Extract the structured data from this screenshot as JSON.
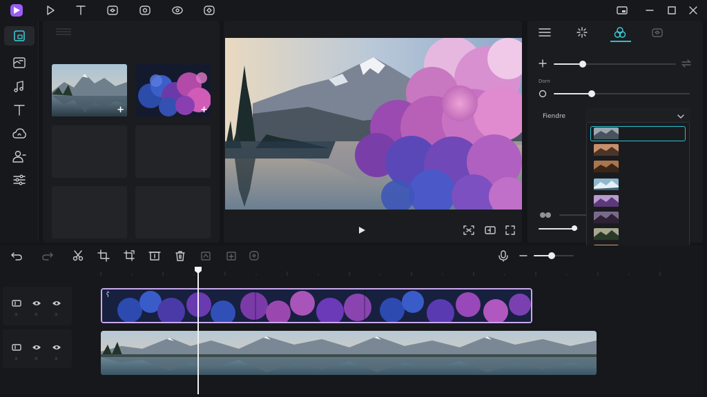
{
  "app": {
    "accent_color": "#27c3d0",
    "logo_color": "#9b5cf6",
    "top_toolbar_icons": [
      "play-icon",
      "text-icon",
      "sticker-icon",
      "effect-icon",
      "eye-icon",
      "transition-icon"
    ],
    "window_controls": [
      "pip-icon",
      "minimize-icon",
      "maximize-icon",
      "close-icon"
    ]
  },
  "sidebar": {
    "items": [
      {
        "name": "media",
        "icon": "folder-icon",
        "active": true
      },
      {
        "name": "stock",
        "icon": "gallery-icon"
      },
      {
        "name": "audio",
        "icon": "music-icon"
      },
      {
        "name": "text",
        "icon": "text-icon"
      },
      {
        "name": "stickers",
        "icon": "cloud-icon"
      },
      {
        "name": "people",
        "icon": "person-icon"
      },
      {
        "name": "adjust",
        "icon": "sliders-icon"
      }
    ]
  },
  "media": {
    "tiles": [
      {
        "name": "mountain-lake",
        "has_add": true
      },
      {
        "name": "colored-smoke",
        "has_add": true
      },
      {
        "name": "empty"
      },
      {
        "name": "empty"
      },
      {
        "name": "empty"
      },
      {
        "name": "empty"
      }
    ],
    "add_symbol": "+"
  },
  "preview": {
    "controls": [
      "play-icon",
      "fit-icon",
      "ratio-icon",
      "fullscreen-icon"
    ]
  },
  "properties": {
    "tabs": [
      "menu-icon",
      "sparkle-icon",
      "blend-icon",
      "lock-icon"
    ],
    "active_tab": 2,
    "opacity_level": 0.2,
    "section_label": "Dorn",
    "second_level": 0.28,
    "blend_label": "Fiendre",
    "bottom_level": 0.9,
    "dropdown_count": 8
  },
  "timeline": {
    "toolbar": [
      "undo-icon",
      "redo-icon",
      "split-icon",
      "crop-icon",
      "transform-icon",
      "freeze-icon",
      "delete-icon",
      "mask-icon",
      "replace-icon",
      "speed-icon",
      "mic-icon",
      "zoom-out-icon",
      "zoom-in-icon"
    ],
    "zoom_level": 0.3,
    "track1": {
      "label_icon": "link-icon",
      "glyph": "ʕ̃"
    },
    "track_head_labels": [
      "a",
      "a",
      "a"
    ]
  }
}
